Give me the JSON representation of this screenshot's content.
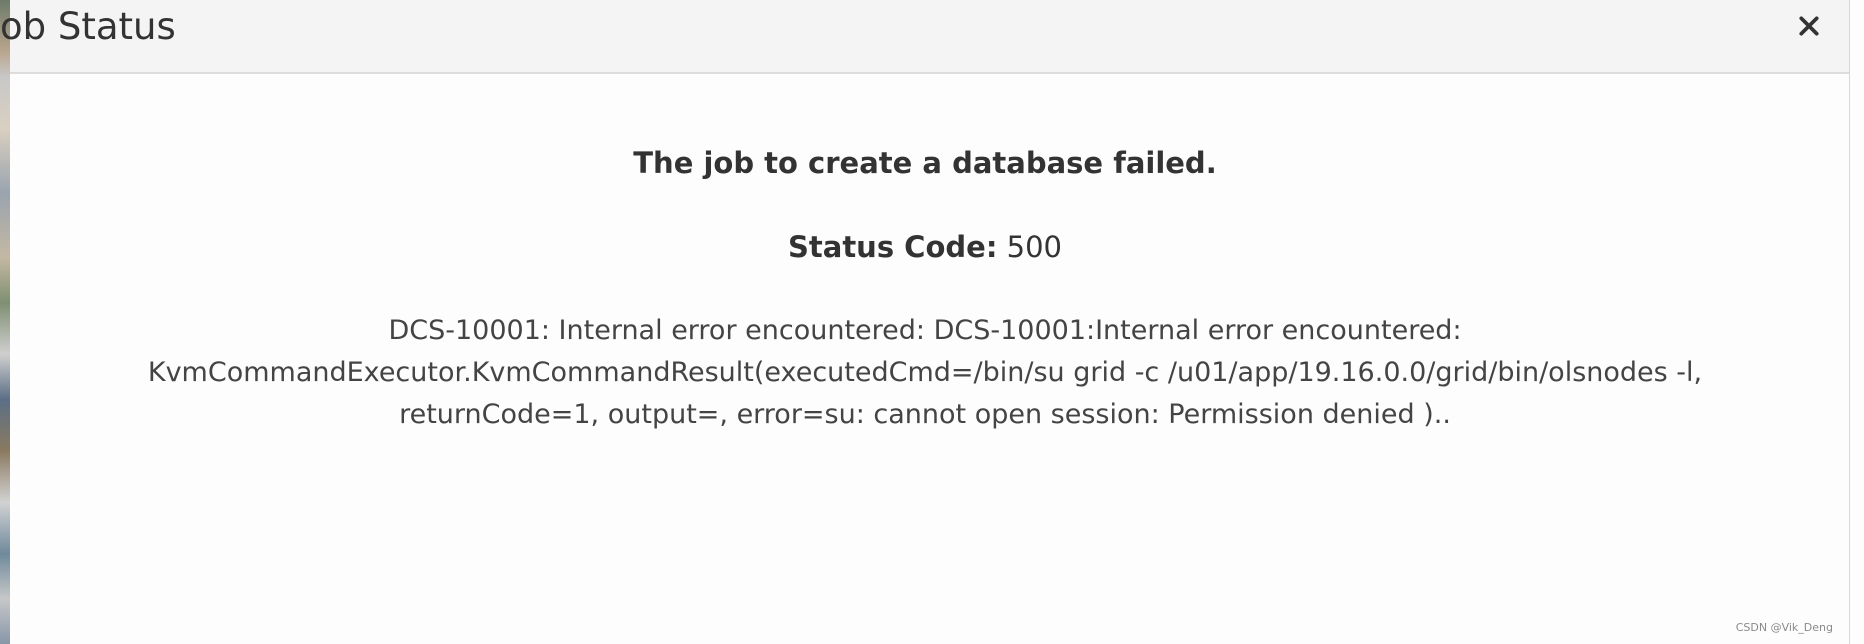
{
  "modal": {
    "title": "ob Status",
    "close_icon": "close-icon",
    "headline": "The job to create a database failed.",
    "status_label": "Status Code:",
    "status_value": " 500",
    "details": "DCS-10001: Internal error encountered: DCS-10001:Internal error encountered: KvmCommandExecutor.KvmCommandResult(executedCmd=/bin/su grid -c /u01/app/19.16.0.0/grid/bin/olsnodes -l, returnCode=1, output=, error=su: cannot open session: Permission denied ).."
  },
  "watermark": "CSDN @Vik_Deng"
}
